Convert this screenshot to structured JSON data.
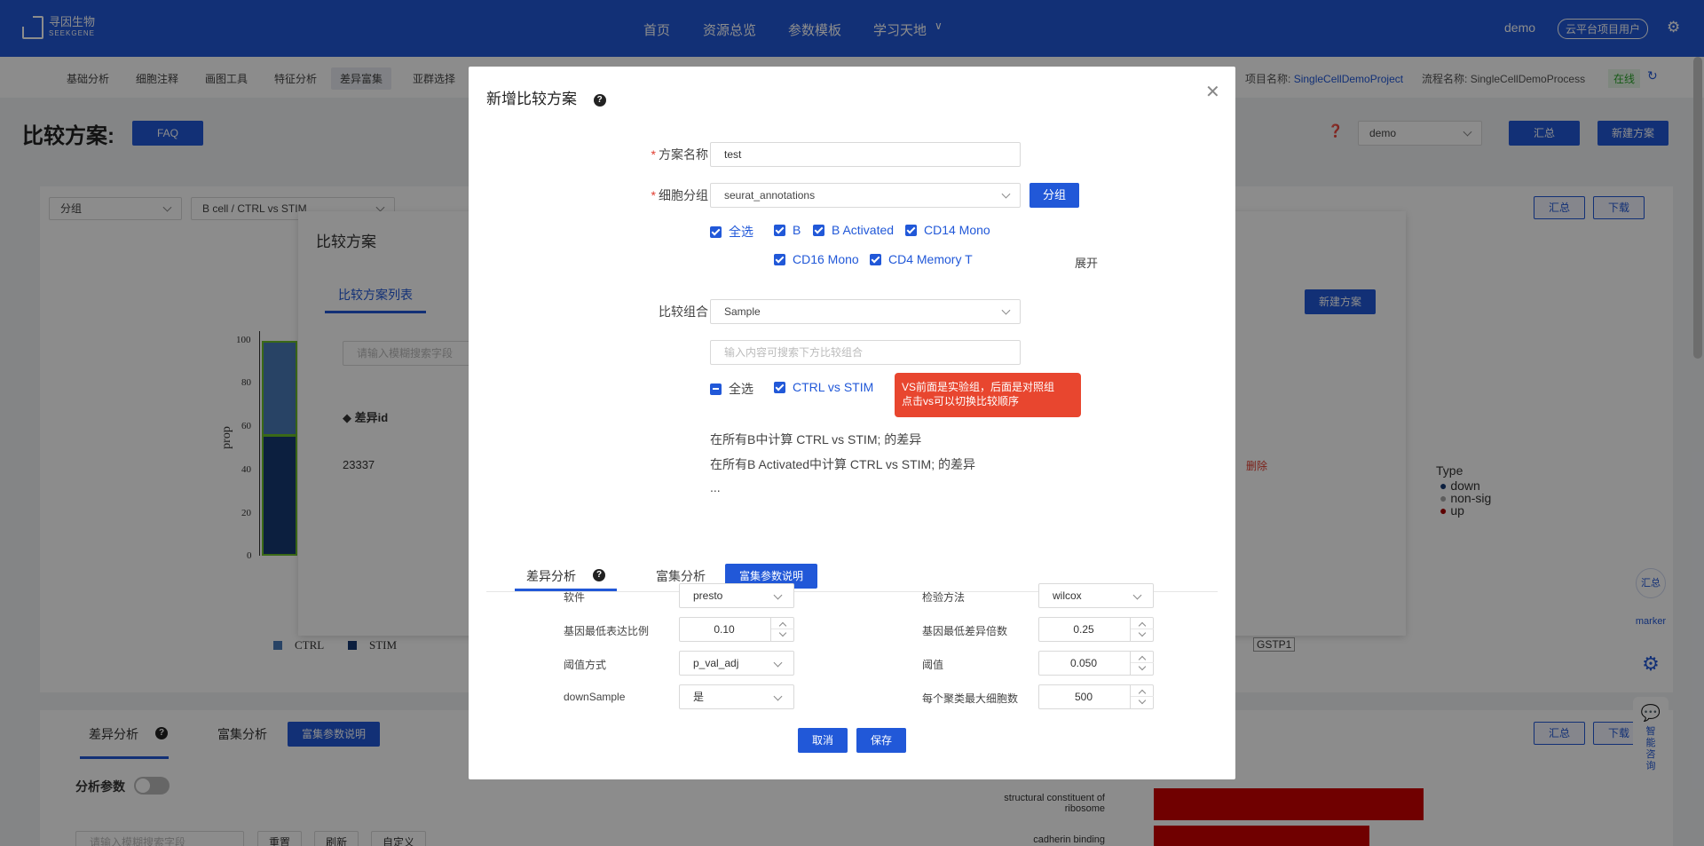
{
  "topbar": {
    "logo_cn": "寻因生物",
    "logo_en": "SEEKGENE",
    "nav": [
      "首页",
      "资源总览",
      "参数模板",
      "学习天地"
    ],
    "user": "demo",
    "cloud_user": "云平台项目用户"
  },
  "subnav": {
    "items": [
      "基础分析",
      "细胞注释",
      "画图工具",
      "特征分析",
      "差异富集",
      "亚群选择"
    ],
    "project_label": "项目名称:",
    "project_name": "SingleCellDemoProject",
    "process_label": "流程名称:",
    "process_name": "SingleCellDemoProcess",
    "status": "在线"
  },
  "page": {
    "title": "比较方案:",
    "faq": "FAQ",
    "user_select": "demo",
    "summary": "汇总",
    "new_plan": "新建方案",
    "filter_group": "分组",
    "filter_compare": "B cell / CTRL vs STIM",
    "download": "下载"
  },
  "bg_dialog": {
    "title": "比较方案",
    "tab": "比较方案列表",
    "search_placeholder": "请输入模糊搜索字段",
    "new_plan": "新建方案",
    "col_id": "差异id",
    "row_id": "23337",
    "delete": "删除"
  },
  "bg_chart": {
    "ylabel": "prop",
    "yticks": [
      "100",
      "80",
      "60",
      "40",
      "20",
      "0"
    ],
    "legend": [
      "CTRL",
      "STIM"
    ],
    "type_title": "Type",
    "types": [
      "down",
      "non-sig",
      "up"
    ],
    "gene_label": "GSTP1",
    "go_terms": [
      "structural constituent of ribosome",
      "cadherin binding"
    ]
  },
  "bottom": {
    "tab_diff": "差异分析",
    "tab_enrich": "富集分析",
    "param_btn": "富集参数说明",
    "analysis_params": "分析参数",
    "search_placeholder": "请输入模糊搜索字段",
    "reset": "重置",
    "refresh": "刷新",
    "custom": "自定义"
  },
  "sidebar": {
    "summary": "汇总",
    "marker": "marker",
    "consult": "智能咨询"
  },
  "modal": {
    "title": "新增比较方案",
    "name_label": "方案名称",
    "name_value": "test",
    "group_label": "细胞分组",
    "group_value": "seurat_annotations",
    "group_btn": "分组",
    "select_all": "全选",
    "cells": [
      "B",
      "B Activated",
      "CD14 Mono",
      "CD16 Mono",
      "CD4 Memory T"
    ],
    "expand": "展开",
    "compare_label": "比较组合",
    "compare_value": "Sample",
    "compare_search_placeholder": "输入内容可搜索下方比较组合",
    "compare_all": "全选",
    "compare_item": "CTRL vs STIM",
    "tip_line1": "VS前面是实验组，后面是对照组",
    "tip_line2": "点击vs可以切换比较顺序",
    "info1": "在所有B中计算 CTRL vs STIM; 的差异",
    "info2": "在所有B Activated中计算 CTRL vs STIM; 的差异",
    "info3": "...",
    "tab_diff": "差异分析",
    "tab_enrich": "富集分析",
    "param_btn": "富集参数说明",
    "params": {
      "software_label": "软件",
      "software": "presto",
      "test_label": "检验方法",
      "test": "wilcox",
      "min_pct_label": "基因最低表达比例",
      "min_pct": "0.10",
      "min_fc_label": "基因最低差异倍数",
      "min_fc": "0.25",
      "threshold_mode_label": "阈值方式",
      "threshold_mode": "p_val_adj",
      "threshold_label": "阈值",
      "threshold": "0.050",
      "downsample_label": "downSample",
      "downsample": "是",
      "max_cells_label": "每个聚类最大细胞数",
      "max_cells": "500"
    },
    "cancel": "取消",
    "save": "保存"
  }
}
